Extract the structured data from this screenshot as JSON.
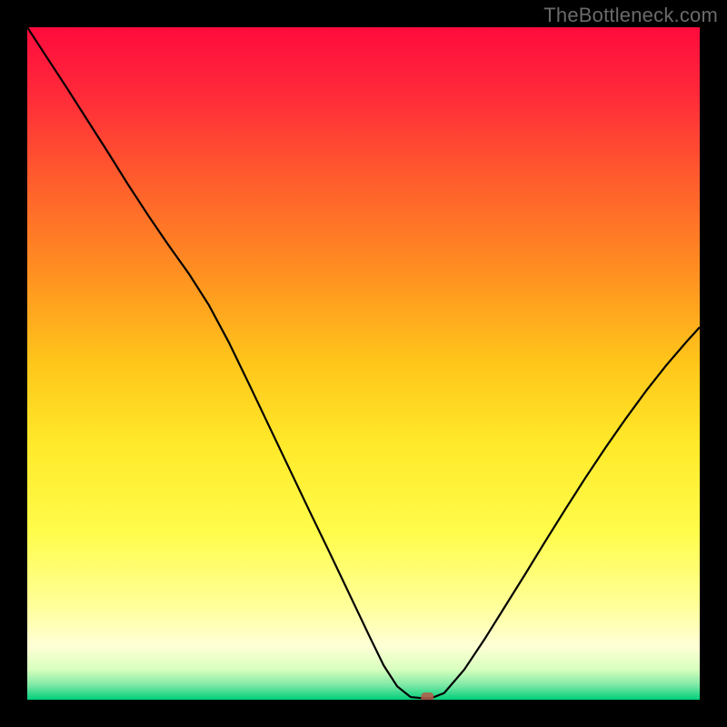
{
  "watermark": "TheBottleneck.com",
  "colors": {
    "gradient": [
      {
        "offset": 0.0,
        "color": "#ff0b3d"
      },
      {
        "offset": 0.1,
        "color": "#ff2a3a"
      },
      {
        "offset": 0.22,
        "color": "#ff5a2d"
      },
      {
        "offset": 0.35,
        "color": "#ff8a22"
      },
      {
        "offset": 0.5,
        "color": "#ffc61a"
      },
      {
        "offset": 0.62,
        "color": "#ffe92a"
      },
      {
        "offset": 0.75,
        "color": "#fffc4a"
      },
      {
        "offset": 0.86,
        "color": "#ffff99"
      },
      {
        "offset": 0.92,
        "color": "#ffffd6"
      },
      {
        "offset": 0.955,
        "color": "#d8ffbe"
      },
      {
        "offset": 0.978,
        "color": "#7fe9a6"
      },
      {
        "offset": 1.0,
        "color": "#00cf7a"
      }
    ],
    "curve": "#000000",
    "marker": "#b55a4a"
  },
  "chart_data": {
    "type": "line",
    "title": "",
    "xlabel": "",
    "ylabel": "",
    "xlim": [
      0,
      100
    ],
    "ylim": [
      0,
      100
    ],
    "x": [
      0,
      3,
      6,
      9,
      12,
      15,
      18,
      21,
      24,
      27,
      30,
      33,
      36,
      39,
      42,
      45,
      48,
      51,
      53,
      55,
      57,
      59,
      60,
      62,
      65,
      68,
      71,
      74,
      77,
      80,
      83,
      86,
      89,
      92,
      95,
      98,
      100
    ],
    "values": [
      100,
      95.4,
      90.8,
      86.1,
      81.4,
      76.6,
      72.0,
      67.6,
      63.4,
      58.7,
      53.1,
      46.9,
      40.6,
      34.3,
      28.0,
      21.8,
      15.5,
      9.2,
      5.1,
      2.0,
      0.4,
      0.2,
      0.2,
      1.0,
      4.5,
      9.0,
      13.8,
      18.6,
      23.5,
      28.3,
      33.0,
      37.5,
      41.8,
      45.9,
      49.7,
      53.2,
      55.4
    ],
    "marker": {
      "x": 59.5,
      "y": 0.4
    }
  }
}
